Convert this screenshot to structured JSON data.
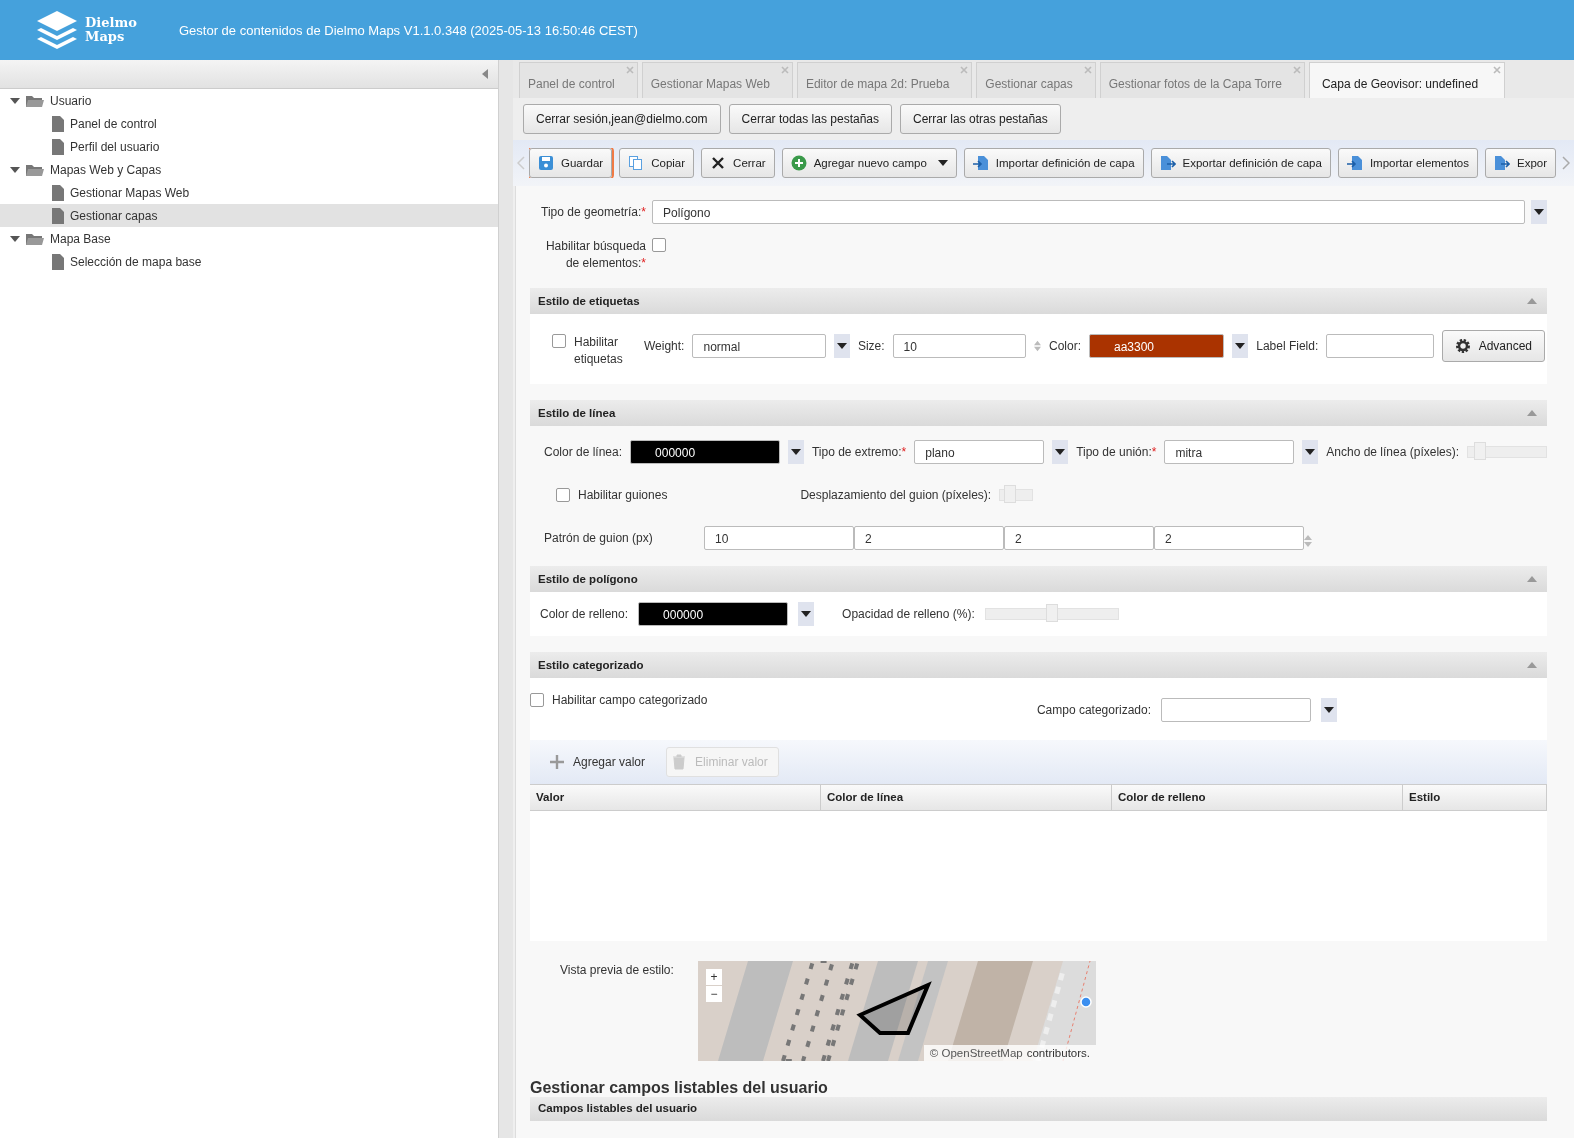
{
  "header": {
    "logo": [
      "Dielmo",
      "Maps"
    ],
    "title": "Gestor de contenidos de Dielmo Maps V1.1.0.348 (2025-05-13 16:50:46 CEST)"
  },
  "sidebar": {
    "items": [
      {
        "label": "Usuario",
        "expanded": true,
        "selected": false,
        "children": [
          {
            "label": "Panel de control",
            "selected": false
          },
          {
            "label": "Perfil del usuario",
            "selected": false
          }
        ]
      },
      {
        "label": "Mapas Web y Capas",
        "expanded": true,
        "selected": false,
        "children": [
          {
            "label": "Gestionar Mapas Web",
            "selected": false
          },
          {
            "label": "Gestionar capas",
            "selected": true
          }
        ]
      },
      {
        "label": "Mapa Base",
        "expanded": true,
        "selected": false,
        "children": [
          {
            "label": "Selección de mapa base",
            "selected": false
          }
        ]
      }
    ]
  },
  "tabs": [
    {
      "label": "Panel de control",
      "selected": false
    },
    {
      "label": "Gestionar Mapas Web",
      "selected": false
    },
    {
      "label": "Editor de mapa 2d: Prueba",
      "selected": false
    },
    {
      "label": "Gestionar capas",
      "selected": false
    },
    {
      "label": "Gestionar fotos de la Capa Torre",
      "selected": false
    },
    {
      "label": "Capa de Geovisor: undefined",
      "selected": true
    }
  ],
  "session_buttons": [
    "Cerrar sesión,jean@dielmo.com",
    "Cerrar todas las pestañas",
    "Cerrar las otras pestañas"
  ],
  "toolbar": [
    {
      "label": "Guardar",
      "kind": "save",
      "focused": true,
      "menu": false
    },
    {
      "label": "Copiar",
      "kind": "copy",
      "focused": false,
      "menu": false
    },
    {
      "label": "Cerrar",
      "kind": "close",
      "focused": false,
      "menu": false
    },
    {
      "label": "Agregar nuevo campo",
      "kind": "add",
      "focused": false,
      "menu": true
    },
    {
      "label": "Importar definición de capa",
      "kind": "import",
      "focused": false,
      "menu": false
    },
    {
      "label": "Exportar definición de capa",
      "kind": "export",
      "focused": false,
      "menu": false
    },
    {
      "label": "Importar elementos",
      "kind": "import",
      "focused": false,
      "menu": false
    },
    {
      "label": "Expor",
      "kind": "export",
      "focused": false,
      "menu": false
    }
  ],
  "geometry": {
    "label": "Tipo de geometría:",
    "required_mark": "*",
    "value": "Polígono"
  },
  "search_enable": {
    "label": "Habilitar búsqueda de elementos:",
    "required_mark": "*",
    "checked": false
  },
  "label_style": {
    "title": "Estilo de etiquetas",
    "expanded": true,
    "enable": {
      "label": "Habilitar etiquetas",
      "checked": false
    },
    "weight": {
      "label": "Weight:",
      "value": "normal"
    },
    "size": {
      "label": "Size:",
      "value": "10"
    },
    "color": {
      "label": "Color:",
      "value": "aa3300"
    },
    "label_field": {
      "label": "Label Field:"
    },
    "advanced": "Advanced"
  },
  "line_style": {
    "title": "Estilo de línea",
    "expanded": true,
    "line_color": {
      "label": "Color de línea:",
      "value": "000000"
    },
    "cap": {
      "label": "Tipo de extremo:",
      "required_mark": "*",
      "value": "plano"
    },
    "join": {
      "label": "Tipo de unión:",
      "required_mark": "*",
      "value": "mitra"
    },
    "width": {
      "label": "Ancho de línea (píxeles):",
      "level": 0.15
    },
    "dashes": {
      "label": "Habilitar guiones",
      "checked": false
    },
    "dash_offset": {
      "label": "Desplazamiento del guion (píxeles):",
      "level": 0.3
    },
    "dash_pattern": {
      "label": "Patrón de guion (px)",
      "values": [
        "10",
        "2",
        "2",
        "2"
      ]
    }
  },
  "polygon_style": {
    "title": "Estilo de polígono",
    "expanded": true,
    "fill_color": {
      "label": "Color de relleno:",
      "value": "000000"
    },
    "fill_opacity": {
      "label": "Opacidad de relleno (%):",
      "level": 0.5
    }
  },
  "categorized": {
    "title": "Estilo categorizado",
    "expanded": true,
    "enable": {
      "label": "Habilitar campo categorizado",
      "checked": false
    },
    "field": {
      "label": "Campo categorizado:"
    },
    "add_button": {
      "label": "Agregar valor",
      "disabled": false
    },
    "remove_button": {
      "label": "Eliminar valor",
      "disabled": true
    },
    "table": {
      "columns": [
        "Valor",
        "Color de línea",
        "Color de relleno",
        "Estilo"
      ]
    }
  },
  "preview": {
    "label": "Vista previa de estilo:",
    "zoom_in": "+",
    "zoom_out": "−",
    "attribution_link": "© OpenStreetMap",
    "attribution_text": "contributors."
  },
  "user_fields": {
    "heading": "Gestionar campos listables del usuario",
    "panel_title": "Campos listables del usuario"
  }
}
